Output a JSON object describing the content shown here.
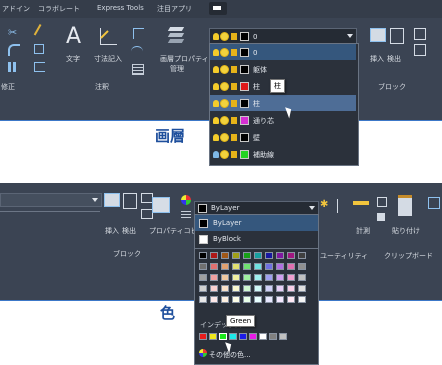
{
  "section1": {
    "tabs": [
      "アドイン",
      "コラボレート",
      "Express Tools",
      "注目アプリ"
    ],
    "ribbon_labels": [
      "文字",
      "寸法記入",
      "画層プロパティ",
      "管理",
      "挿入",
      "検出"
    ],
    "group_labels": [
      "修正",
      "注釈",
      "ブロック"
    ],
    "current_layer": "0",
    "layers": [
      {
        "name": "0",
        "color": "#000000",
        "bulb": "yellow",
        "selected": false
      },
      {
        "name": "躯体",
        "color": "#000000",
        "bulb": "yellow",
        "selected": false
      },
      {
        "name": "柱",
        "color": "#e0191a",
        "bulb": "yellow",
        "selected": false
      },
      {
        "name": "柱",
        "color": "#000000",
        "bulb": "yellow",
        "selected": true
      },
      {
        "name": "通り芯",
        "color": "#d52fd2",
        "bulb": "yellow",
        "selected": false
      },
      {
        "name": "壁",
        "color": "#000000",
        "bulb": "yellow",
        "selected": false
      },
      {
        "name": "補助線",
        "color": "#22d322",
        "bulb": "blue",
        "selected": false
      }
    ],
    "tooltip": "柱",
    "caption": "画層"
  },
  "section2": {
    "ribbon_labels": [
      "挿入",
      "検出",
      "プロパティコピー",
      "計測",
      "貼り付け"
    ],
    "group_labels": [
      "ブロック",
      "ユーティリティ",
      "クリップボード"
    ],
    "current_color": "ByLayer",
    "options": [
      "ByLayer",
      "ByBlock"
    ],
    "index_label": "インデックス",
    "tooltip": "Green",
    "more_colors": "その他の色...",
    "caption": "色",
    "standard_colors": [
      "#e81c1c",
      "#f0e81c",
      "#1ce81c",
      "#1ce8e8",
      "#1c1ce8",
      "#e81ce8",
      "#ffffff",
      "#808080",
      "#c0c0c0"
    ]
  }
}
